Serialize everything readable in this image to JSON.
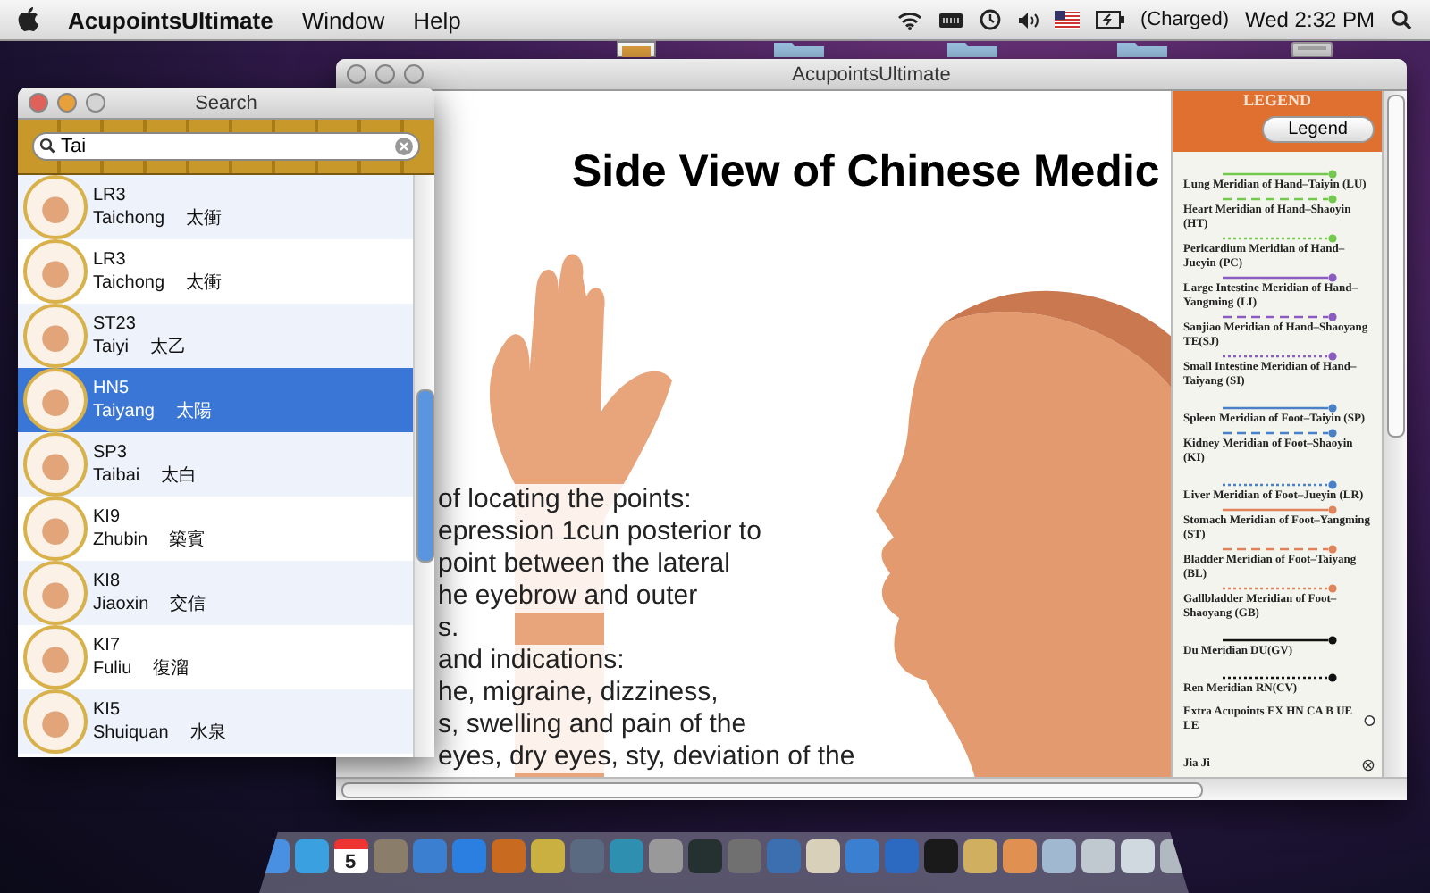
{
  "menu_bar": {
    "app_name": "AcupointsUltimate",
    "menus": [
      "Window",
      "Help"
    ],
    "battery_status": "(Charged)",
    "clock": "Wed 2:32 PM"
  },
  "main_window": {
    "title": "AcupointsUltimate",
    "document_title": "Side View of Chinese Medic",
    "overlay_text": [
      "of locating the points:",
      "epression 1cun posterior to",
      "point between the lateral",
      "he eyebrow and outer",
      "s.",
      "and indications:",
      "he, migraine, dizziness,",
      "s, swelling and pain of the",
      "eyes, dry eyes, sty, deviation of the"
    ],
    "legend": {
      "heading": "LEGEND",
      "button": "Legend",
      "items": [
        {
          "kind": "line",
          "dashed": false,
          "dotted": false,
          "color": "#72c94e",
          "label": "Lung Meridian of Hand–Taiyin   (LU)"
        },
        {
          "kind": "line",
          "dashed": true,
          "dotted": false,
          "color": "#72c94e",
          "label": "Heart Meridian of Hand–Shaoyin   (HT)"
        },
        {
          "kind": "line",
          "dashed": false,
          "dotted": true,
          "color": "#72c94e",
          "label": "Pericardium Meridian of Hand–Jueyin (PC)"
        },
        {
          "kind": "line",
          "dashed": false,
          "dotted": false,
          "color": "#8a5cc2",
          "label": "Large Intestine Meridian of Hand–Yangming (LI)"
        },
        {
          "kind": "line",
          "dashed": true,
          "dotted": false,
          "color": "#8a5cc2",
          "label": "Sanjiao Meridian of Hand–Shaoyang TE(SJ)"
        },
        {
          "kind": "line",
          "dashed": false,
          "dotted": true,
          "color": "#8a5cc2",
          "label": "Small Intestine Meridian of Hand–Taiyang (SI)"
        },
        {
          "kind": "line",
          "dashed": false,
          "dotted": false,
          "color": "#4a80c8",
          "label": "Spleen Meridian of Foot–Taiyin   (SP)"
        },
        {
          "kind": "line",
          "dashed": true,
          "dotted": false,
          "color": "#4a80c8",
          "label": "Kidney Meridian of Foot–Shaoyin   (KI)"
        },
        {
          "kind": "line",
          "dashed": false,
          "dotted": true,
          "color": "#4a80c8",
          "label": "Liver Meridian of Foot–Jueyin   (LR)"
        },
        {
          "kind": "line",
          "dashed": false,
          "dotted": false,
          "color": "#e0835a",
          "label": "Stomach Meridian of Foot–Yangming   (ST)"
        },
        {
          "kind": "line",
          "dashed": true,
          "dotted": false,
          "color": "#e0835a",
          "label": "Bladder Meridian of Foot–Taiyang   (BL)"
        },
        {
          "kind": "line",
          "dashed": false,
          "dotted": true,
          "color": "#e0835a",
          "label": "Gallbladder Meridian of Foot–Shaoyang (GB)"
        },
        {
          "kind": "line",
          "dashed": false,
          "dotted": false,
          "color": "#111111",
          "label": "Du Meridian   DU(GV)"
        },
        {
          "kind": "line",
          "dashed": false,
          "dotted": true,
          "color": "#111111",
          "label": "Ren Meridian   RN(CV)"
        },
        {
          "kind": "hollow_point",
          "label": "Extra Acupoints EX  HN  CA  B  UE  LE"
        },
        {
          "kind": "cross_point",
          "label": "Jia Ji"
        }
      ]
    }
  },
  "search_window": {
    "title": "Search",
    "query": "Tai",
    "results": [
      {
        "code": "LR3",
        "pinyin": "Taichong",
        "chinese": "太衝",
        "selected": false
      },
      {
        "code": "LR3",
        "pinyin": "Taichong",
        "chinese": "太衝",
        "selected": false
      },
      {
        "code": "ST23",
        "pinyin": "Taiyi",
        "chinese": "太乙",
        "selected": false
      },
      {
        "code": "HN5",
        "pinyin": "Taiyang",
        "chinese": "太陽",
        "selected": true
      },
      {
        "code": "SP3",
        "pinyin": "Taibai",
        "chinese": "太白",
        "selected": false
      },
      {
        "code": "KI9",
        "pinyin": "Zhubin",
        "chinese": "築賓",
        "selected": false
      },
      {
        "code": "KI8",
        "pinyin": "Jiaoxin",
        "chinese": "交信",
        "selected": false
      },
      {
        "code": "KI7",
        "pinyin": "Fuliu",
        "chinese": "復溜",
        "selected": false
      },
      {
        "code": "KI5",
        "pinyin": "Shuiquan",
        "chinese": "水泉",
        "selected": false
      }
    ]
  },
  "dock": {
    "calendar_day": "5"
  }
}
